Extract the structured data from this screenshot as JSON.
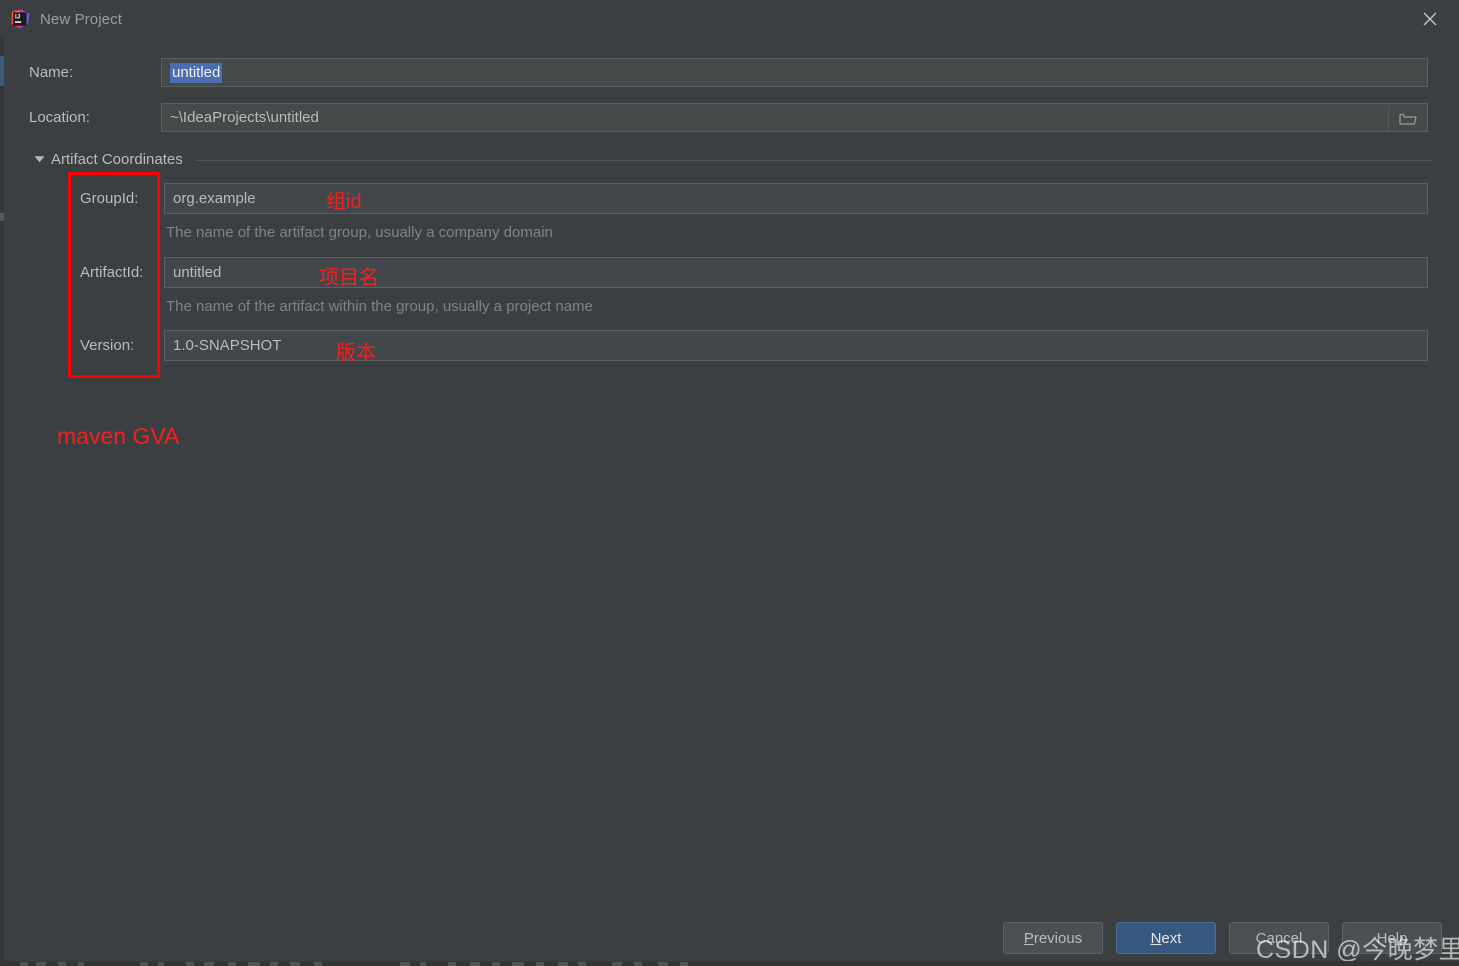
{
  "window": {
    "title": "New Project",
    "app_icon": "intellij-idea-icon",
    "close_icon": "close-icon"
  },
  "form": {
    "name": {
      "label": "Name:",
      "value": "untitled",
      "selected": true
    },
    "location": {
      "label": "Location:",
      "value": "~\\IdeaProjects\\untitled",
      "browse_icon": "folder-icon"
    }
  },
  "artifact_coordinates": {
    "group_title": "Artifact Coordinates",
    "expanded": true,
    "arrow_icon": "chevron-down-icon",
    "group_id": {
      "label": "GroupId:",
      "value": "org.example",
      "hint": "The name of the artifact group, usually a company domain"
    },
    "artifact_id": {
      "label": "ArtifactId:",
      "value": "untitled",
      "hint": "The name of the artifact within the group, usually a project name"
    },
    "version": {
      "label": "Version:",
      "value": "1.0-SNAPSHOT"
    }
  },
  "annotations": {
    "color": "#f32020",
    "box_color": "#fe0000",
    "group_id_note": "组id",
    "artifact_id_note": "项目名",
    "version_note": "版本",
    "maven_note": "maven GVA"
  },
  "footer": {
    "previous": "Previous",
    "previous_mnemonic": "P",
    "next": "Next",
    "next_mnemonic": "N",
    "cancel": "Cancel",
    "help": "Help",
    "next_accent": "#365880"
  },
  "watermark": {
    "text": "CSDN @今晚梦里见i"
  }
}
